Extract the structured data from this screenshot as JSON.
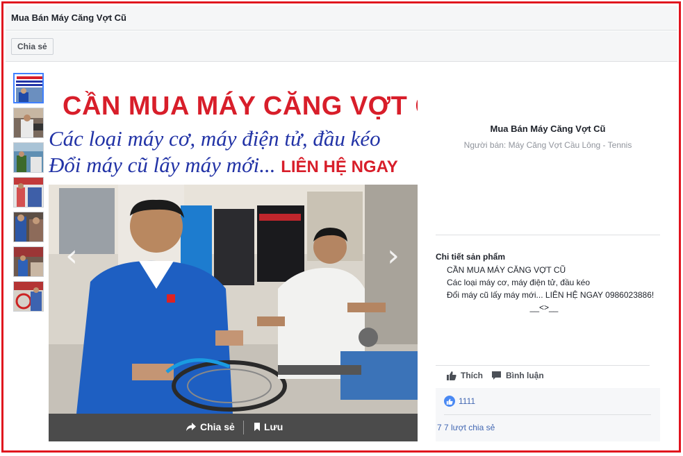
{
  "header": {
    "title": "Mua Bán Máy Căng Vợt Cũ"
  },
  "toolbar": {
    "share_label": "Chia sẻ"
  },
  "gallery": {
    "banner_line1": "CẦN MUA MÁY CĂNG VỢT CŨ",
    "banner_line2": "Các loại máy cơ, máy điện tử, đầu kéo",
    "banner_line3": "Đổi máy cũ lấy máy mới... ",
    "banner_line3_emph": "LIÊN HỆ NGAY",
    "share_label": "Chia sẻ",
    "save_label": "Lưu",
    "prev_glyph": "‹",
    "next_glyph": "›"
  },
  "product": {
    "title": "Mua Bán Máy Căng Vợt Cũ",
    "seller": "Người bán: Máy Căng Vợt Cầu Lông - Tennis",
    "details_heading": "Chi tiết sản phẩm",
    "details_line1": "CẦN MUA MÁY CĂNG VỢT CŨ",
    "details_line2": "Các loại máy cơ, máy điện tử, đầu kéo",
    "details_line3": "Đổi máy cũ lấy máy mới... LIÊN HỆ NGAY 0986023886!",
    "details_line4": "__<>__"
  },
  "actions": {
    "like_label": "Thích",
    "comment_label": "Bình luận"
  },
  "stats": {
    "likes": "1111",
    "shares": "7 7 lượt chia sẻ"
  },
  "colors": {
    "frame": "#e0141e",
    "link": "#4267b2",
    "banner_red": "#d81e2a",
    "banner_blue": "#2233a6"
  }
}
